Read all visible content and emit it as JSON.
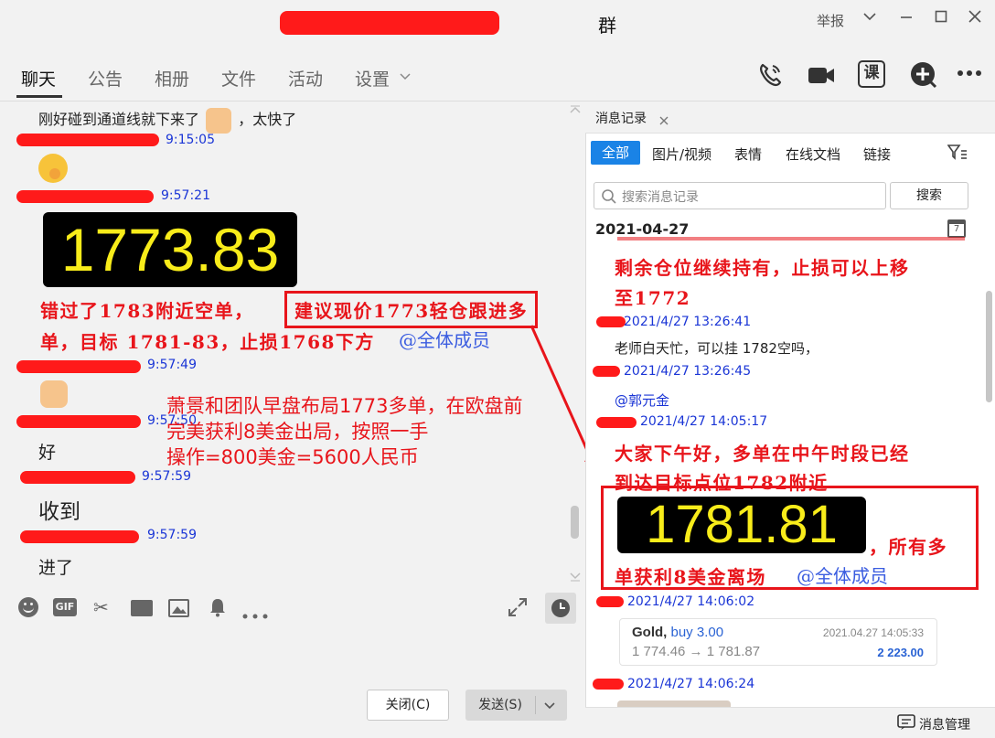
{
  "window": {
    "title": "群",
    "report_label": "举报"
  },
  "nav": {
    "tabs": [
      "聊天",
      "公告",
      "相册",
      "文件",
      "活动",
      "设置"
    ],
    "class_icon_label": "课"
  },
  "chat": {
    "msg1": "刚好碰到通道线就下来了",
    "msg1_tail": "，太快了",
    "ts1": "9:15:05",
    "ts2": "9:57:21",
    "price1": "1773.83",
    "red_line1_a": "错过了1783附近空单，",
    "red_line1_b": "建议现价1773轻仓跟进多",
    "red_line2": "单，目标 1781-83，止损1768下方",
    "at_all": "@全体成员",
    "ts3": "9:57:49",
    "ts4": "9:57:50",
    "msg_hao": "好",
    "ts5": "9:57:59",
    "msg_shoudao": "收到",
    "ts6": "9:57:59",
    "msg_jinle": "进了",
    "annotation_l1": "萧景和团队早盘布局1773多单，在欧盘前",
    "annotation_l2": "完美获利8美金出局，按照一手",
    "annotation_l3": "操作=800美金=5600人民币"
  },
  "composer": {
    "close_label": "关闭(C)",
    "send_label": "发送(S)"
  },
  "history": {
    "panel_title": "消息记录",
    "filters": [
      "全部",
      "图片/视频",
      "表情",
      "在线文档",
      "链接"
    ],
    "search_placeholder": "搜索消息记录",
    "search_button": "搜索",
    "date": "2021-04-27",
    "calendar_day": "7",
    "red1": "剩余仓位继续持有，止损可以上移",
    "red2": "至1772",
    "ts1": "2021/4/27 13:26:41",
    "msg1": "老师白天忙，可以挂 1782空吗，",
    "ts2": "2021/4/27 13:26:45",
    "at_user": "@郭元金",
    "ts3": "2021/4/27 14:05:17",
    "red3": "大家下午好，多单在中午时段已经",
    "red4": "到达目标点位1782附近",
    "price2": "1781.81",
    "red5": "，所有多",
    "red6": "单获利8美金离场",
    "at_all": "@全体成员",
    "ts4": "2021/4/27 14:06:02",
    "trade_symbol": "Gold,",
    "trade_side": "buy 3.00",
    "trade_prices": "1 774.46 → 1 781.87",
    "trade_time": "2021.04.27 14:05:33",
    "trade_profit": "2 223.00",
    "ts5": "2021/4/27 14:06:24",
    "manage_label": "消息管理"
  },
  "colors": {
    "accent_blue": "#1a83e6",
    "annotation_red": "#e8151b",
    "price_yellow": "#f8ec1a",
    "timestamp_blue": "#1a35d6"
  }
}
